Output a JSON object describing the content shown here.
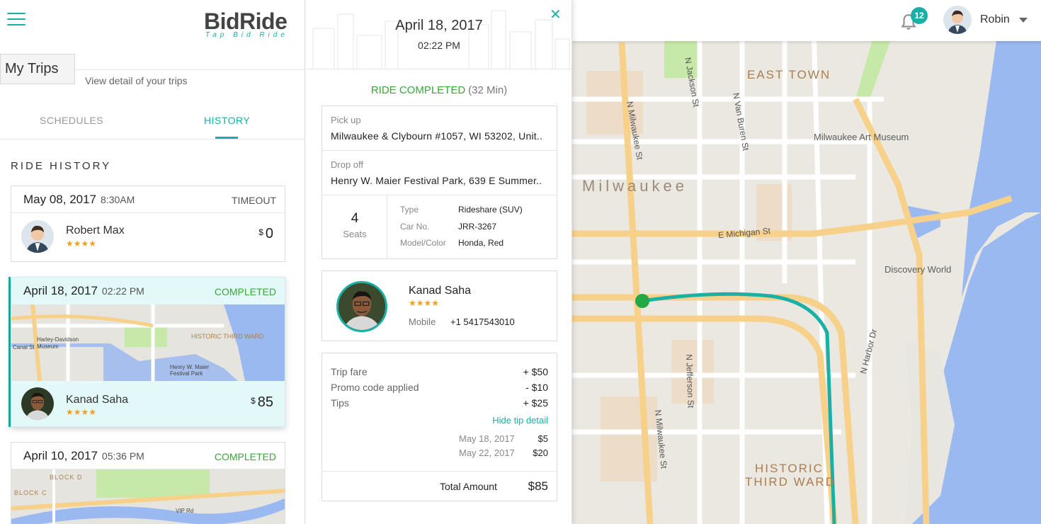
{
  "header": {
    "logo_text": "BidRide",
    "logo_tagline": "Tap Bid Ride",
    "page_title": "My Trips",
    "page_subtitle": "View detail of your trips"
  },
  "tabs": [
    {
      "label": "SCHEDULES",
      "active": false
    },
    {
      "label": "HISTORY",
      "active": true
    }
  ],
  "ride_history_title": "RIDE HISTORY",
  "rides": [
    {
      "date": "May 08, 2017",
      "time": "8:30AM",
      "status": "TIMEOUT",
      "status_color": "#555555",
      "name": "Robert Max",
      "stars": "★★★★",
      "price_symbol": "$",
      "price": "0"
    },
    {
      "date": "April 18, 2017",
      "time": "02:22 PM",
      "status": "COMPLETED",
      "status_color": "#3aa63a",
      "name": "Kanad Saha",
      "stars": "★★★★",
      "price_symbol": "$",
      "price": "85",
      "map_labels": {
        "historic": "HISTORIC THIRD WARD",
        "museum": "Harley-Davidson Museum",
        "park": "Henry W. Maier Festival Park",
        "canal": "Canal St"
      }
    },
    {
      "date": "April 10, 2017",
      "time": "05:36 PM",
      "status": "COMPLETED",
      "status_color": "#3aa63a",
      "map_labels": {
        "block_d": "BLOCK D",
        "block_c": "BLOCK C",
        "road": "VIP Rd"
      }
    }
  ],
  "detail": {
    "date": "April 18, 2017",
    "time": "02:22 PM",
    "status": "RIDE COMPLETED",
    "duration": "(32 Min)",
    "pickup_label": "Pick up",
    "pickup": "Milwaukee & Clybourn #1057, WI 53202, Unit..",
    "dropoff_label": "Drop off",
    "dropoff": "Henry W. Maier Festival Park, 639 E Summer..",
    "seats": "4",
    "seats_label": "Seats",
    "vehicle": [
      {
        "label": "Type",
        "value": "Rideshare (SUV)"
      },
      {
        "label": "Car No.",
        "value": "JRR-3267"
      },
      {
        "label": "Model/Color",
        "value": "Honda, Red"
      }
    ],
    "driver": {
      "name": "Kanad Saha",
      "stars": "★★★★",
      "mobile_label": "Mobile",
      "mobile": "+1 5417543010"
    },
    "fare": [
      {
        "label": "Trip fare",
        "amount": "+ $50"
      },
      {
        "label": "Promo code applied",
        "amount": "- $10"
      },
      {
        "label": "Tips",
        "amount": "+ $25"
      }
    ],
    "hide_tip_label": "Hide tip detail",
    "tips": [
      {
        "date": "May 18, 2017",
        "amount": "$5"
      },
      {
        "date": "May 22, 2017",
        "amount": "$20"
      }
    ],
    "total_label": "Total Amount",
    "total": "$85"
  },
  "topbar": {
    "notification_count": "12",
    "user_name": "Robin"
  },
  "map": {
    "districts": [
      "EAST TOWN",
      "HISTORIC",
      "THIRD WARD"
    ],
    "city": "Milwaukee",
    "pois": [
      "Milwaukee Art Museum",
      "Discovery World"
    ],
    "streets": [
      "N Jackson St",
      "N Van Buren St",
      "N Milwaukee St",
      "E Michigan St",
      "N Jefferson St",
      "N Milwaukee St",
      "N Harbor Dr"
    ],
    "route_color": "#1ab0a6",
    "origin_color": "#22a845"
  }
}
